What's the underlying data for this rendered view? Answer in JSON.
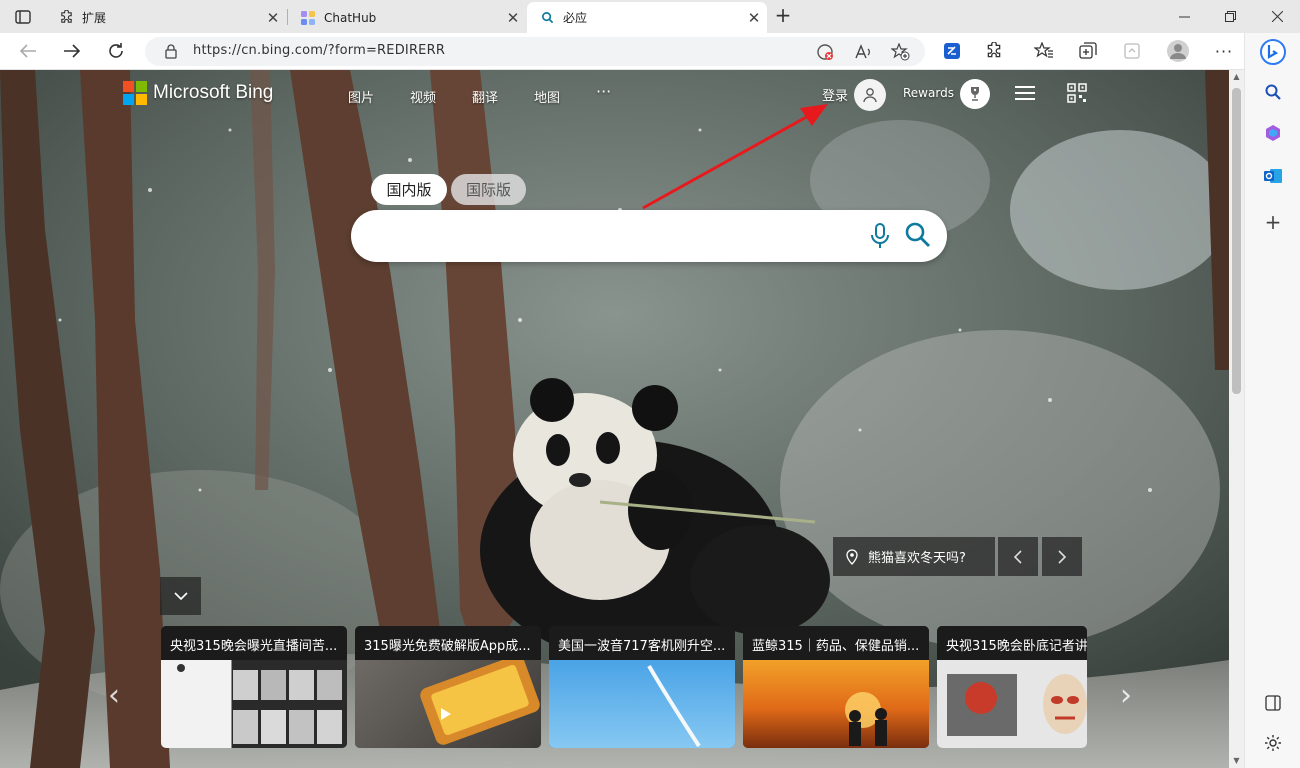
{
  "browser": {
    "tabs": [
      {
        "label": "扩展",
        "icon": "puzzle-icon"
      },
      {
        "label": "ChatHub",
        "icon": "chathub-icon"
      },
      {
        "label": "必应",
        "icon": "search-icon",
        "active": true
      }
    ],
    "url": "https://cn.bing.com/?form=REDIRERR"
  },
  "bing": {
    "logo_text": "Microsoft Bing",
    "nav": [
      "图片",
      "视频",
      "翻译",
      "地图"
    ],
    "more": "···",
    "signin": "登录",
    "rewards": "Rewards",
    "region_tabs": [
      "国内版",
      "国际版"
    ],
    "search_placeholder": "",
    "location_caption": "熊猫喜欢冬天吗?"
  },
  "news_cards": [
    {
      "title": "央视315晚会曝光直播间苦..."
    },
    {
      "title": "315曝光免费破解版App成..."
    },
    {
      "title": "美国一波音717客机刚升空..."
    },
    {
      "title": "蓝鲸315｜药品、保健品销..."
    },
    {
      "title": "央视315晚会卧底记者讲"
    }
  ],
  "colors": {
    "accent": "#0e7a9e",
    "ms_red": "#f25022",
    "ms_green": "#7fba00",
    "ms_blue": "#00a4ef",
    "ms_yellow": "#ffb900",
    "annotation_arrow": "#e8191c"
  }
}
